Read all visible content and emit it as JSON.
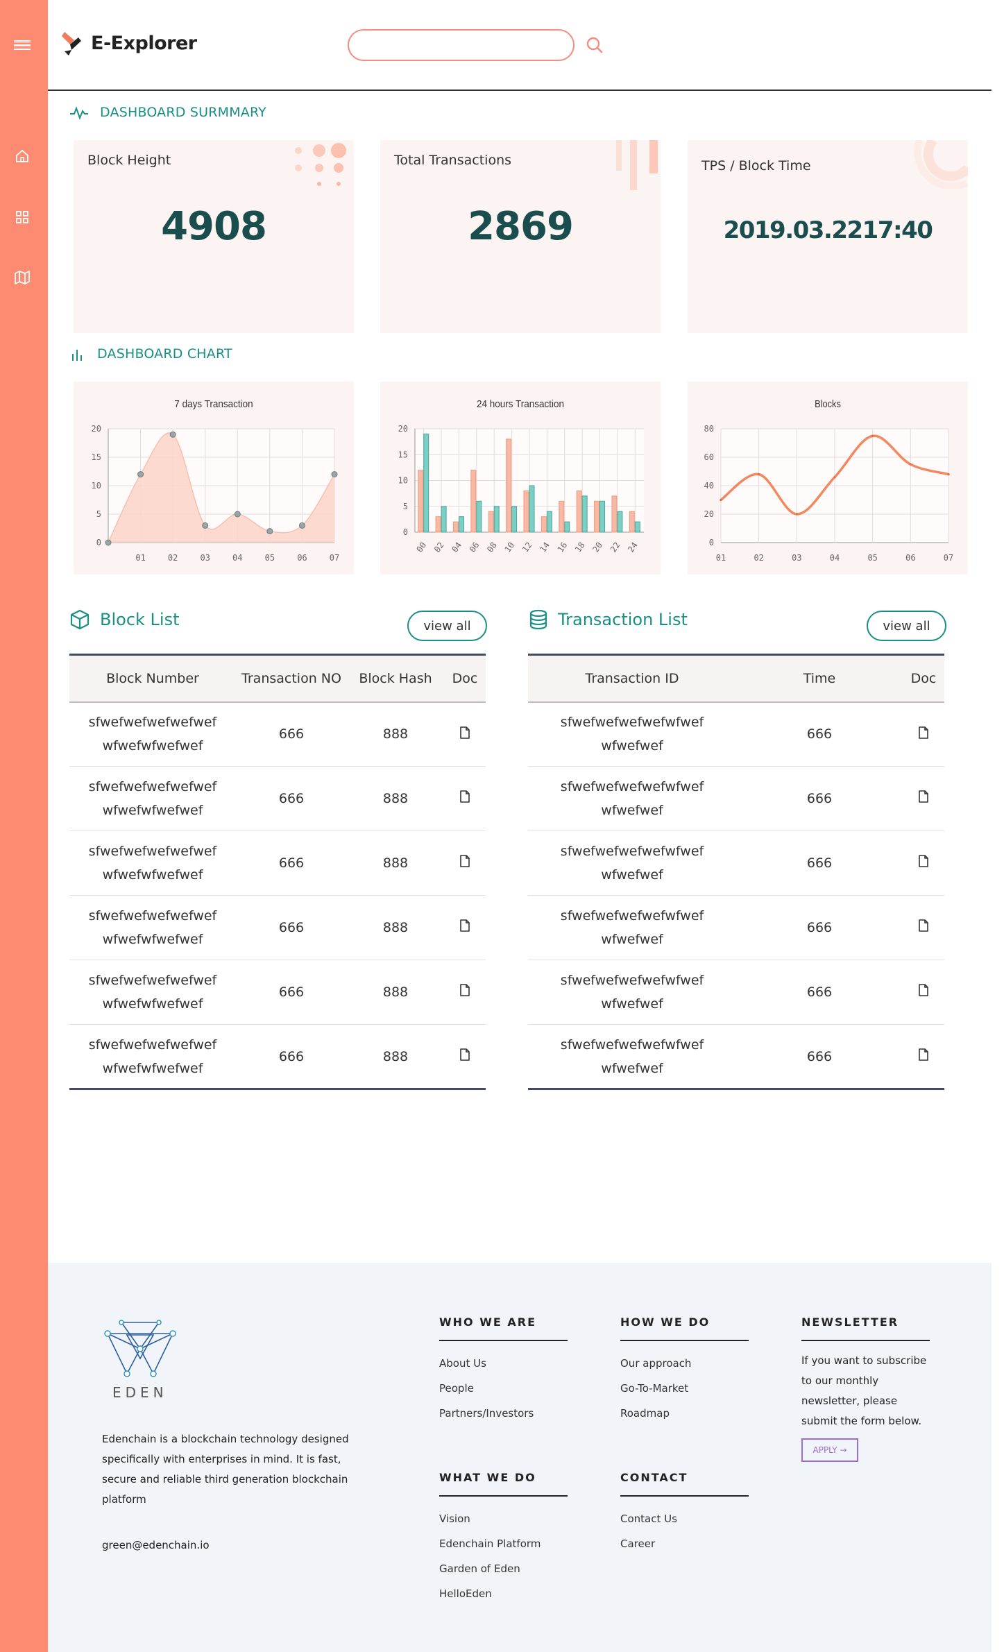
{
  "header": {
    "app_name": "E-Explorer",
    "search_placeholder": ""
  },
  "summary": {
    "title": "DASHBOARD SURMMARY",
    "cards": [
      {
        "label": "Block Height",
        "value": "4908"
      },
      {
        "label": "Total Transactions",
        "value": "2869"
      },
      {
        "label": "TPS / Block Time",
        "value": "2019.03.2217:40"
      }
    ]
  },
  "charts_section": {
    "title": "DASHBOARD CHART"
  },
  "chart_data": [
    {
      "type": "area",
      "title": "7 days Transaction",
      "x": [
        "01",
        "02",
        "03",
        "04",
        "05",
        "06",
        "07"
      ],
      "values": [
        12,
        19,
        3,
        5,
        2,
        3,
        12
      ],
      "start_value": 0,
      "ylim": [
        0,
        20
      ],
      "yticks": [
        "0",
        "5",
        "10",
        "15",
        "20"
      ],
      "color": "#fbd3c8",
      "grid": true
    },
    {
      "type": "bar",
      "title": "24 hours Transaction",
      "categories": [
        "00",
        "02",
        "04",
        "06",
        "08",
        "10",
        "12",
        "14",
        "16",
        "18",
        "20",
        "22",
        "24"
      ],
      "series": [
        {
          "color": "#f7b9a4",
          "values": [
            12,
            3,
            2,
            12,
            4,
            18,
            8,
            3,
            6,
            8,
            6,
            7,
            4
          ]
        },
        {
          "color": "#7ccfc4",
          "values": [
            19,
            5,
            3,
            6,
            5,
            5,
            9,
            4,
            2,
            7,
            6,
            4,
            2
          ]
        }
      ],
      "ylim": [
        0,
        20
      ],
      "yticks": [
        "0",
        "5",
        "10",
        "15",
        "20"
      ],
      "grid": true
    },
    {
      "type": "line",
      "title": "Blocks",
      "x": [
        "01",
        "02",
        "03",
        "04",
        "05",
        "06",
        "07"
      ],
      "values": [
        30,
        48,
        20,
        46,
        75,
        55,
        48
      ],
      "ylim": [
        0,
        80
      ],
      "yticks": [
        "0",
        "20",
        "40",
        "60",
        "80"
      ],
      "color": "#f28860",
      "grid": true
    }
  ],
  "block_list": {
    "title": "Block List",
    "view_all": "view all",
    "columns": [
      "Block Number",
      "Transaction NO",
      "Block Hash",
      "Doc"
    ],
    "rows": [
      {
        "number_1": "sfwefwefwefwefwef",
        "number_2": "wfwefwfwefwef",
        "tx_no": "666",
        "hash": "888"
      },
      {
        "number_1": "sfwefwefwefwefwef",
        "number_2": "wfwefwfwefwef",
        "tx_no": "666",
        "hash": "888"
      },
      {
        "number_1": "sfwefwefwefwefwef",
        "number_2": "wfwefwfwefwef",
        "tx_no": "666",
        "hash": "888"
      },
      {
        "number_1": "sfwefwefwefwefwef",
        "number_2": "wfwefwfwefwef",
        "tx_no": "666",
        "hash": "888"
      },
      {
        "number_1": "sfwefwefwefwefwef",
        "number_2": "wfwefwfwefwef",
        "tx_no": "666",
        "hash": "888"
      },
      {
        "number_1": "sfwefwefwefwefwef",
        "number_2": "wfwefwfwefwef",
        "tx_no": "666",
        "hash": "888"
      }
    ]
  },
  "transaction_list": {
    "title": "Transaction List",
    "view_all": "view all",
    "columns": [
      "Transaction ID",
      "Time",
      "Doc"
    ],
    "rows": [
      {
        "id_1": "sfwefwefwefwefwfwef",
        "id_2": "wfwefwef",
        "time": "666"
      },
      {
        "id_1": "sfwefwefwefwefwfwef",
        "id_2": "wfwefwef",
        "time": "666"
      },
      {
        "id_1": "sfwefwefwefwefwfwef",
        "id_2": "wfwefwef",
        "time": "666"
      },
      {
        "id_1": "sfwefwefwefwefwfwef",
        "id_2": "wfwefwef",
        "time": "666"
      },
      {
        "id_1": "sfwefwefwefwefwfwef",
        "id_2": "wfwefwef",
        "time": "666"
      },
      {
        "id_1": "sfwefwefwefwefwfwef",
        "id_2": "wfwefwef",
        "time": "666"
      }
    ]
  },
  "footer": {
    "brand": "EDEN",
    "description": "Edenchain is a blockchain technology designed specifically with enterprises in mind. It is fast, secure and reliable third generation blockchain platform",
    "email": "green@edenchain.io",
    "who_we_are": {
      "title": "WHO WE ARE",
      "links": [
        "About Us",
        "People",
        "Partners/Investors"
      ]
    },
    "how_we_do": {
      "title": "HOW WE DO",
      "links": [
        "Our approach",
        "Go-To-Market",
        "Roadmap"
      ]
    },
    "newsletter": {
      "title": "NEWSLETTER",
      "text": "If you want to subscribe to our monthly newsletter, please submit the form below.",
      "apply": "APPLY"
    },
    "what_we_do": {
      "title": "WHAT WE DO",
      "links": [
        "Vision",
        "Edenchain Platform",
        "Garden of Eden",
        "HelloEden"
      ]
    },
    "contact": {
      "title": "CONTACT",
      "links": [
        "Contact Us",
        "Career"
      ]
    }
  },
  "icons": {
    "menu": "menu-icon",
    "home": "home-icon",
    "grid": "grid-icon",
    "map": "map-icon",
    "search": "search-icon",
    "pulse": "pulse-icon",
    "bar": "bar-chart-icon",
    "cube": "cube-icon",
    "database": "database-icon",
    "doc": "doc-icon"
  },
  "colors": {
    "sidebar": "#fc8b72",
    "accent": "#1a8f86",
    "value": "#1a4d4d",
    "card_bg": "#fcf4f2"
  }
}
